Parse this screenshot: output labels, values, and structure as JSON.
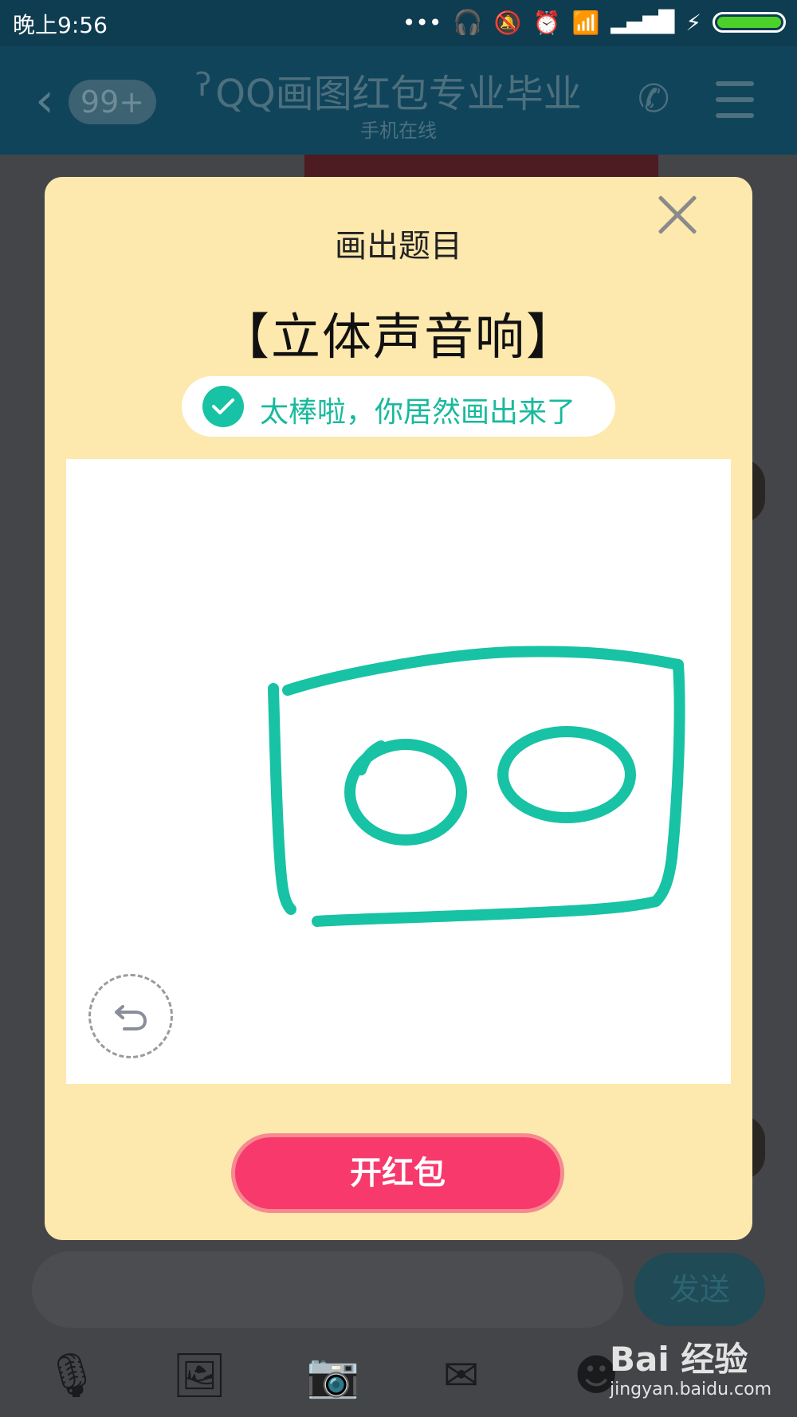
{
  "status_bar": {
    "time": "晚上9:56"
  },
  "header": {
    "badge": "99+",
    "title": "QQ画图红包专业毕业",
    "subtitle": "手机在线"
  },
  "modal": {
    "heading": "画出题目",
    "topic": "【立体声音响】",
    "success_message": "太棒啦，你居然画出来了",
    "open_button": "开红包"
  },
  "input_bar": {
    "send_label": "发送"
  },
  "watermark": {
    "logo": "Bai 经验",
    "url": "jingyan.baidu.com"
  },
  "colors": {
    "modal_bg": "#fde8ae",
    "accent_teal": "#18c2a4",
    "open_button": "#f7396b"
  }
}
